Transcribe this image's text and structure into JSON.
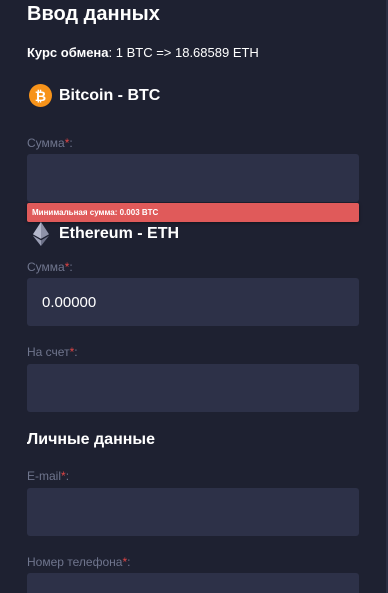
{
  "form": {
    "title": "Ввод данных",
    "rate_label": "Курс обмена",
    "rate_value": ": 1 BTC => 18.68589 ETH"
  },
  "from_currency": {
    "name": "Bitcoin - BTC",
    "icon": "bitcoin-icon",
    "icon_color": "#f7931a",
    "amount_label": "Сумма",
    "amount_value": "",
    "error": "Минимальная сумма: 0.003 BTC"
  },
  "to_currency": {
    "name": "Ethereum - ETH",
    "icon": "ethereum-icon",
    "amount_label": "Сумма",
    "amount_value": "0.00000",
    "account_label": "На счет",
    "account_value": ""
  },
  "personal": {
    "title": "Личные данные",
    "email_label": "E-mail",
    "email_value": "",
    "phone_label": "Номер телефона",
    "phone_value": ""
  },
  "required_mark": "*",
  "colors": {
    "background": "#1e2131",
    "field": "#2d3148",
    "error": "#e05a5a",
    "required": "#e04545",
    "label": "#6f758d"
  }
}
